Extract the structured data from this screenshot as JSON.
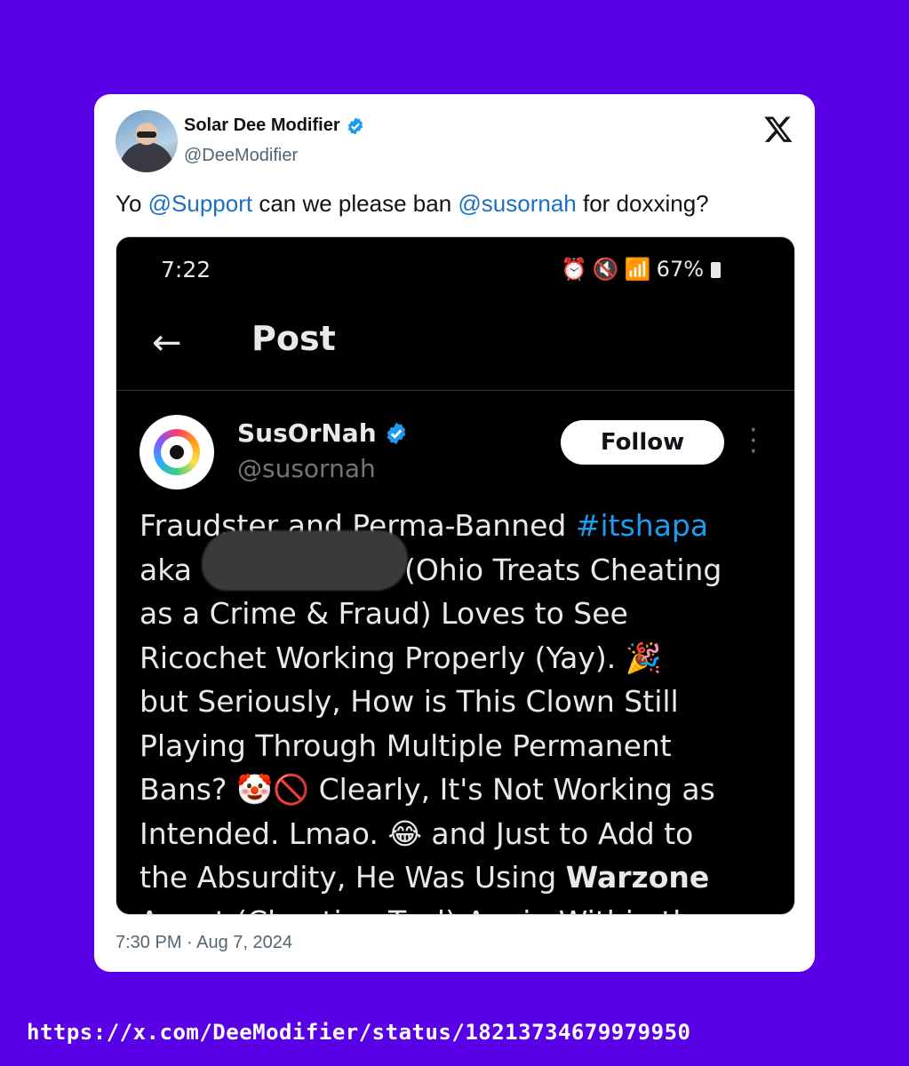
{
  "tweet": {
    "author_name": "Solar Dee Modifier",
    "author_handle": "@DeeModifier",
    "text_prefix": "Yo ",
    "mention_1": "@Support",
    "text_middle": " can we please ban ",
    "mention_2": "@susornah",
    "text_suffix": " for doxxing?",
    "timestamp": "7:30 PM · Aug 7, 2024"
  },
  "screenshot": {
    "status_time": "7:22",
    "battery": "67%",
    "header_title": "Post",
    "account_name": "SusOrNah",
    "account_handle": "@susornah",
    "follow_label": "Follow",
    "body": {
      "line1_prefix": "Fraudster and Perma-Banned ",
      "hashtag": "#itshapa",
      "line2_prefix": "aka ",
      "line2_suffix": " (Ohio Treats Cheating",
      "line3": "as a Crime & Fraud) Loves to See",
      "line4": "Ricochet Working Properly (Yay). 🎉",
      "line5": "but Seriously, How is This Clown Still",
      "line6": "Playing Through Multiple Permanent",
      "line7": "Bans? 🤡🚫 Clearly, It's Not Working as",
      "line8": "Intended. Lmao. 😂 and Just to Add to",
      "line9_prefix": "the Absurdity, He Was Using ",
      "line9_bold": "Warzone",
      "line10": "Agent (Cheating Tool) Again Within the"
    }
  },
  "footer_url": "https://x.com/DeeModifier/status/1821373467997995​0",
  "colors": {
    "background": "#5a00e6",
    "mention_blue": "#1d6fc4",
    "hashtag_blue": "#1d9bf0",
    "verified_blue": "#1d9bf0"
  },
  "icons": [
    "verified-badge-icon",
    "x-logo-icon",
    "back-arrow-icon",
    "alarm-icon",
    "mute-icon",
    "wifi-icon",
    "signal-icon",
    "battery-icon",
    "more-options-icon"
  ]
}
